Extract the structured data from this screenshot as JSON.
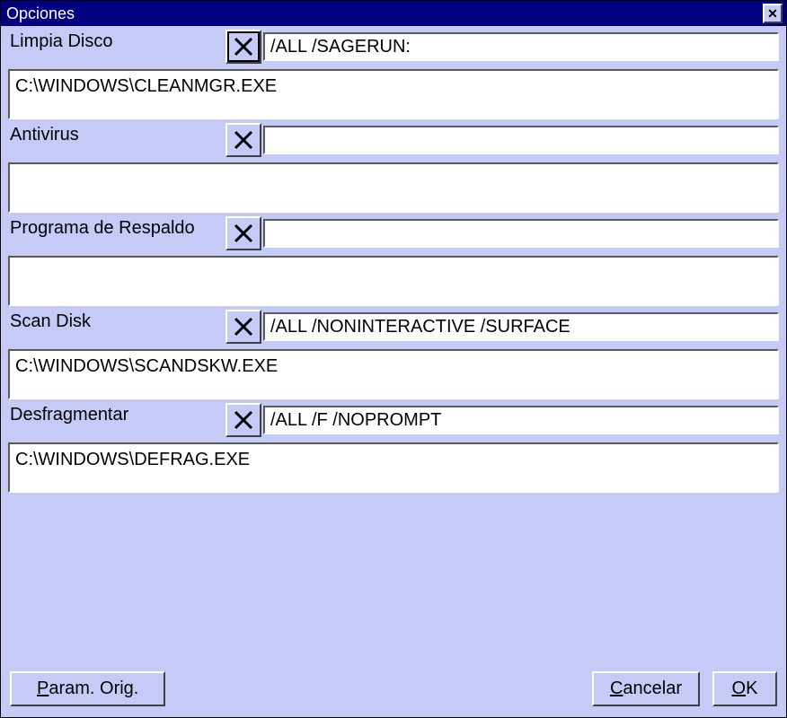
{
  "window": {
    "title": "Opciones"
  },
  "sections": {
    "limpia": {
      "label": "Limpia Disco",
      "args": "/ALL /SAGERUN:",
      "path": "C:\\WINDOWS\\CLEANMGR.EXE",
      "selected": true
    },
    "antivirus": {
      "label": "Antivirus",
      "args": "",
      "path": ""
    },
    "respaldo": {
      "label": "Programa de Respaldo",
      "args": "",
      "path": ""
    },
    "scandisk": {
      "label": "Scan Disk",
      "args": "/ALL /NONINTERACTIVE /SURFACE",
      "path": "C:\\WINDOWS\\SCANDSKW.EXE"
    },
    "defrag": {
      "label": "Desfragmentar",
      "args": "/ALL /F /NOPROMPT",
      "path": "C:\\WINDOWS\\DEFRAG.EXE"
    }
  },
  "buttons": {
    "param_pre": "P",
    "param_post": "aram. Orig.",
    "cancel_pre": "C",
    "cancel_post": "ancelar",
    "ok_pre": "O",
    "ok_post": "K"
  }
}
